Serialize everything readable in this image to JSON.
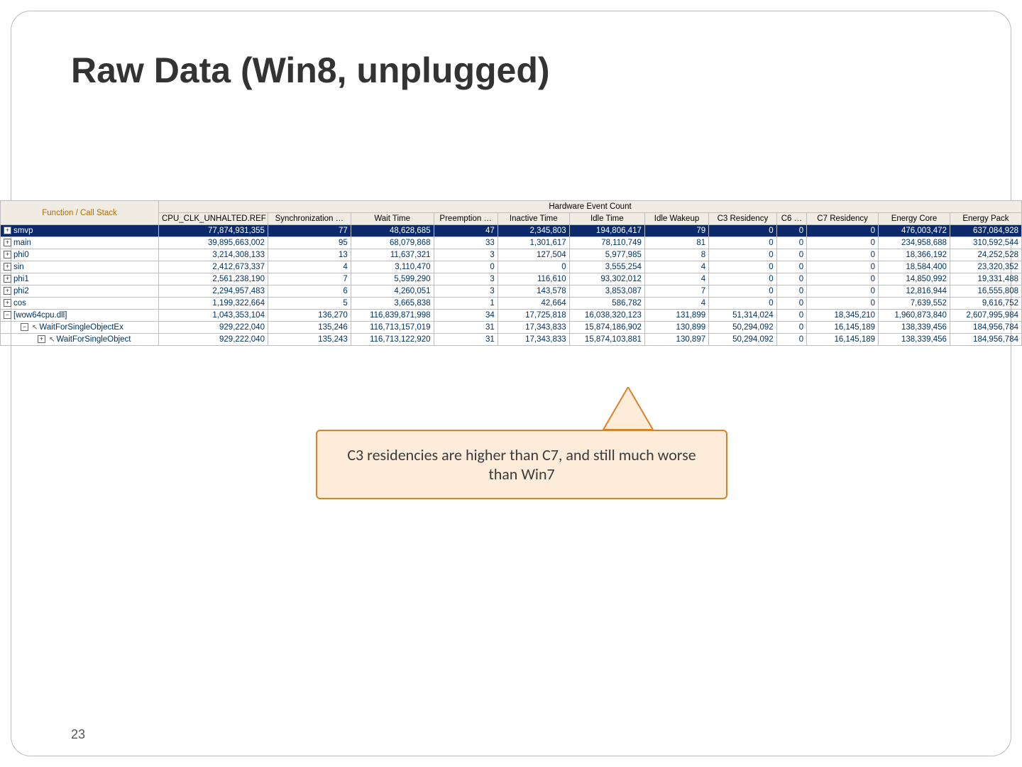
{
  "title": "Raw Data (Win8, unplugged)",
  "page_number": "23",
  "callout_text": "C3 residencies are higher than C7, and still much worse than Win7",
  "table": {
    "fn_header": "Function / Call Stack",
    "group_header": "Hardware Event Count",
    "columns": [
      "CPU_CLK_UNHALTED.REF …",
      "Synchronization …",
      "Wait Time",
      "Preemption …",
      "Inactive Time",
      "Idle Time",
      "Idle Wakeup",
      "C3 Residency",
      "C6 …",
      "C7 Residency",
      "Energy Core",
      "Energy Pack"
    ],
    "rows": [
      {
        "indent": 0,
        "icon": "plus",
        "selected": true,
        "fn": "smvp",
        "cells": [
          "77,874,931,355",
          "77",
          "48,628,685",
          "47",
          "2,345,803",
          "194,806,417",
          "79",
          "0",
          "0",
          "0",
          "476,003,472",
          "637,084,928"
        ]
      },
      {
        "indent": 0,
        "icon": "plus",
        "selected": false,
        "fn": "main",
        "cells": [
          "39,895,663,002",
          "95",
          "68,079,868",
          "33",
          "1,301,617",
          "78,110,749",
          "81",
          "0",
          "0",
          "0",
          "234,958,688",
          "310,592,544"
        ]
      },
      {
        "indent": 0,
        "icon": "plus",
        "selected": false,
        "fn": "phi0",
        "cells": [
          "3,214,308,133",
          "13",
          "11,637,321",
          "3",
          "127,504",
          "5,977,985",
          "8",
          "0",
          "0",
          "0",
          "18,366,192",
          "24,252,528"
        ]
      },
      {
        "indent": 0,
        "icon": "plus",
        "selected": false,
        "fn": "sin",
        "cells": [
          "2,412,673,337",
          "4",
          "3,110,470",
          "0",
          "0",
          "3,555,254",
          "4",
          "0",
          "0",
          "0",
          "18,584,400",
          "23,320,352"
        ]
      },
      {
        "indent": 0,
        "icon": "plus",
        "selected": false,
        "fn": "phi1",
        "cells": [
          "2,561,238,190",
          "7",
          "5,599,290",
          "3",
          "116,610",
          "93,302,012",
          "4",
          "0",
          "0",
          "0",
          "14,850,992",
          "19,331,488"
        ]
      },
      {
        "indent": 0,
        "icon": "plus",
        "selected": false,
        "fn": "phi2",
        "cells": [
          "2,294,957,483",
          "6",
          "4,260,051",
          "3",
          "143,578",
          "3,853,087",
          "7",
          "0",
          "0",
          "0",
          "12,816,944",
          "16,555,808"
        ]
      },
      {
        "indent": 0,
        "icon": "plus",
        "selected": false,
        "fn": "cos",
        "cells": [
          "1,199,322,664",
          "5",
          "3,665,838",
          "1",
          "42,664",
          "586,782",
          "4",
          "0",
          "0",
          "0",
          "7,639,552",
          "9,616,752"
        ]
      },
      {
        "indent": 0,
        "icon": "minus",
        "selected": false,
        "fn": "[wow64cpu.dll]",
        "cells": [
          "1,043,353,104",
          "136,270",
          "116,839,871,998",
          "34",
          "17,725,818",
          "16,038,320,123",
          "131,899",
          "51,314,024",
          "0",
          "18,345,210",
          "1,960,873,840",
          "2,607,995,984"
        ]
      },
      {
        "indent": 1,
        "icon": "minus",
        "arrow": true,
        "selected": false,
        "fn": "WaitForSingleObjectEx",
        "cells": [
          "929,222,040",
          "135,246",
          "116,713,157,019",
          "31",
          "17,343,833",
          "15,874,186,902",
          "130,899",
          "50,294,092",
          "0",
          "16,145,189",
          "138,339,456",
          "184,956,784"
        ]
      },
      {
        "indent": 2,
        "icon": "plus",
        "arrow": true,
        "selected": false,
        "fn": "WaitForSingleObject",
        "cells": [
          "929,222,040",
          "135,243",
          "116,713,122,920",
          "31",
          "17,343,833",
          "15,874,103,881",
          "130,897",
          "50,294,092",
          "0",
          "16,145,189",
          "138,339,456",
          "184,956,784"
        ]
      }
    ]
  }
}
